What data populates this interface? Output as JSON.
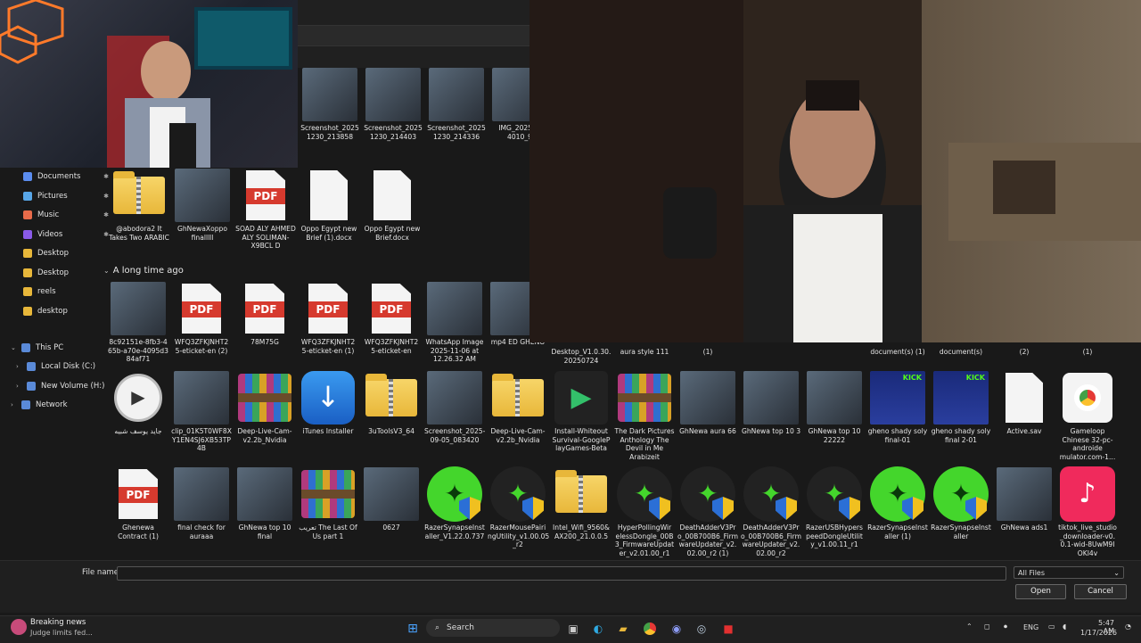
{
  "nav": {
    "items": [
      {
        "label": "Documents",
        "icon": "documents-icon",
        "color": "#5b8def",
        "pinned": true
      },
      {
        "label": "Pictures",
        "icon": "pictures-icon",
        "color": "#58a6e8",
        "pinned": true
      },
      {
        "label": "Music",
        "icon": "music-icon",
        "color": "#e86b4a",
        "pinned": true
      },
      {
        "label": "Videos",
        "icon": "videos-icon",
        "color": "#8a5ae8",
        "pinned": true
      },
      {
        "label": "Desktop",
        "icon": "folder-icon",
        "color": "#e8b73a",
        "pinned": false
      },
      {
        "label": "Desktop",
        "icon": "folder-icon",
        "color": "#e8b73a",
        "pinned": false
      },
      {
        "label": "reels",
        "icon": "folder-icon",
        "color": "#e8b73a",
        "pinned": false
      },
      {
        "label": "desktop",
        "icon": "folder-icon",
        "color": "#e8b73a",
        "pinned": false
      }
    ],
    "tree": [
      {
        "label": "This PC",
        "icon": "pc-icon",
        "expand": "⌄"
      },
      {
        "label": "Local Disk (C:)",
        "icon": "drive-icon",
        "expand": "›"
      },
      {
        "label": "New Volume (H:)",
        "icon": "drive-icon",
        "expand": "›"
      },
      {
        "label": "Network",
        "icon": "network-icon",
        "expand": "›"
      }
    ]
  },
  "top_row": [
    {
      "label": "Screenshot_2025 1230_213858"
    },
    {
      "label": "Screenshot_2025 1230_214403"
    },
    {
      "label": "Screenshot_2025 1230_214336"
    },
    {
      "label": "IMG_202512 4010_9"
    }
  ],
  "earlier_row": [
    {
      "label": "@abodora2 It Takes Two ARABIC",
      "kind": "zip"
    },
    {
      "label": "GhNewaXoppo finalllll",
      "kind": "photo"
    },
    {
      "label": "SOAD ALY AHMED ALY SOLIMAN-X9BCL D",
      "kind": "pdf"
    },
    {
      "label": "Oppo Egypt new Brief (1).docx",
      "kind": "doc"
    },
    {
      "label": "Oppo Egypt new Brief.docx",
      "kind": "doc"
    }
  ],
  "group_header": "A long time ago",
  "long_row1": [
    {
      "label": "8c92151e-8fb3-4 65b-a70e-4095d3 84af71",
      "kind": "photo"
    },
    {
      "label": "WFQ3ZFKJNHT2 5-eticket-en (2)",
      "kind": "pdf"
    },
    {
      "label": "78M75G",
      "kind": "pdf"
    },
    {
      "label": "WFQ3ZFKJNHT2 5-eticket-en (1)",
      "kind": "pdf"
    },
    {
      "label": "WFQ3ZFKJNHT2 5-eticket-en",
      "kind": "pdf"
    },
    {
      "label": "WhatsApp Image 2025-11-06 at 12.26.32 AM",
      "kind": "photo"
    },
    {
      "label": "mp4 ED GHENO",
      "kind": "photo"
    }
  ],
  "long_row1_right": [
    {
      "label": "Desktop_V1.0.30. 20250724"
    },
    {
      "label": "aura style 111"
    },
    {
      "label": "(1)"
    },
    {
      "label": "document(s) (1)"
    },
    {
      "label": "document(s)"
    },
    {
      "label": "(2)"
    },
    {
      "label": "(1)"
    }
  ],
  "long_row2": [
    {
      "label": "جايد يوسف شبيه",
      "kind": "mp4"
    },
    {
      "label": "clip_01K5T0WF8X Y1EN4SJ6XB53TP 4B",
      "kind": "photo"
    },
    {
      "label": "Deep-Live-Cam- v2.2b_Nvidia",
      "kind": "rar"
    },
    {
      "label": "iTunes Installer",
      "kind": "itunes"
    },
    {
      "label": "3uToolsV3_64",
      "kind": "zip"
    },
    {
      "label": "Screenshot_2025- 09-05_083420",
      "kind": "photo"
    },
    {
      "label": "Deep-Live-Cam- v2.2b_Nvidia",
      "kind": "zip"
    },
    {
      "label": "Install-Whiteout Survival-GoogleP layGames-Beta",
      "kind": "gplay"
    },
    {
      "label": "The Dark Pictures Anthology The Devil in Me Arabizeit",
      "kind": "rar"
    },
    {
      "label": "GhNewa aura 66",
      "kind": "photo"
    },
    {
      "label": "GhNewa top 10 3",
      "kind": "photo"
    },
    {
      "label": "GhNewa top 10 22222",
      "kind": "photo"
    },
    {
      "label": "gheno shady soly final-01",
      "kind": "kick"
    },
    {
      "label": "gheno shady soly final 2-01",
      "kind": "kick"
    },
    {
      "label": "Active.sav",
      "kind": "doc"
    },
    {
      "label": "Gameloop Chinese 32-pc-androide mulator.com-1...",
      "kind": "chrome"
    }
  ],
  "long_row3": [
    {
      "label": "Ghenewa Contract (1)",
      "kind": "pdf"
    },
    {
      "label": "final check for auraaa",
      "kind": "photo"
    },
    {
      "label": "GhNewa top 10 final",
      "kind": "photo"
    },
    {
      "label": "تعريب The Last Of Us part 1",
      "kind": "rar"
    },
    {
      "label": "0627",
      "kind": "photo"
    },
    {
      "label": "RazerSynapseInst aller_V1.22.0.737",
      "kind": "razer"
    },
    {
      "label": "RazerMousePairi ngUtility_v1.00.05 _r2",
      "kind": "razer-dark"
    },
    {
      "label": "Intel_Wifi_9560& AX200_21.0.0.5",
      "kind": "zip"
    },
    {
      "label": "HyperPollingWir elessDongle_00B 3_FirmwareUpdat er_v2.01.00_r1",
      "kind": "razer-dark"
    },
    {
      "label": "DeathAdderV3Pr o_00B700B6_Firm wareUpdater_v2. 02.00_r2 (1)",
      "kind": "razer-dark"
    },
    {
      "label": "DeathAdderV3Pr o_00B700B6_Firm wareUpdater_v2. 02.00_r2",
      "kind": "razer-dark"
    },
    {
      "label": "RazerUSBHypers peedDongleUtilit y_v1.00.11_r1",
      "kind": "razer-dark"
    },
    {
      "label": "RazerSynapseInst aller (1)",
      "kind": "razer"
    },
    {
      "label": "RazerSynapseInst aller",
      "kind": "razer"
    },
    {
      "label": "GhNewa ads1",
      "kind": "photo"
    },
    {
      "label": "tiktok_live_studio _downloader-v0. 0.1-wid-8UwM9I OKI4v",
      "kind": "tiktok"
    }
  ],
  "footer": {
    "file_name_label": "File name:",
    "file_name_value": "",
    "filter": "All Files",
    "open": "Open",
    "cancel": "Cancel"
  },
  "taskbar": {
    "news_title": "Breaking news",
    "news_sub": "Judge limits fed...",
    "search": "Search",
    "lang": "ENG",
    "time": "5:47 AM",
    "date": "1/17/2026"
  }
}
